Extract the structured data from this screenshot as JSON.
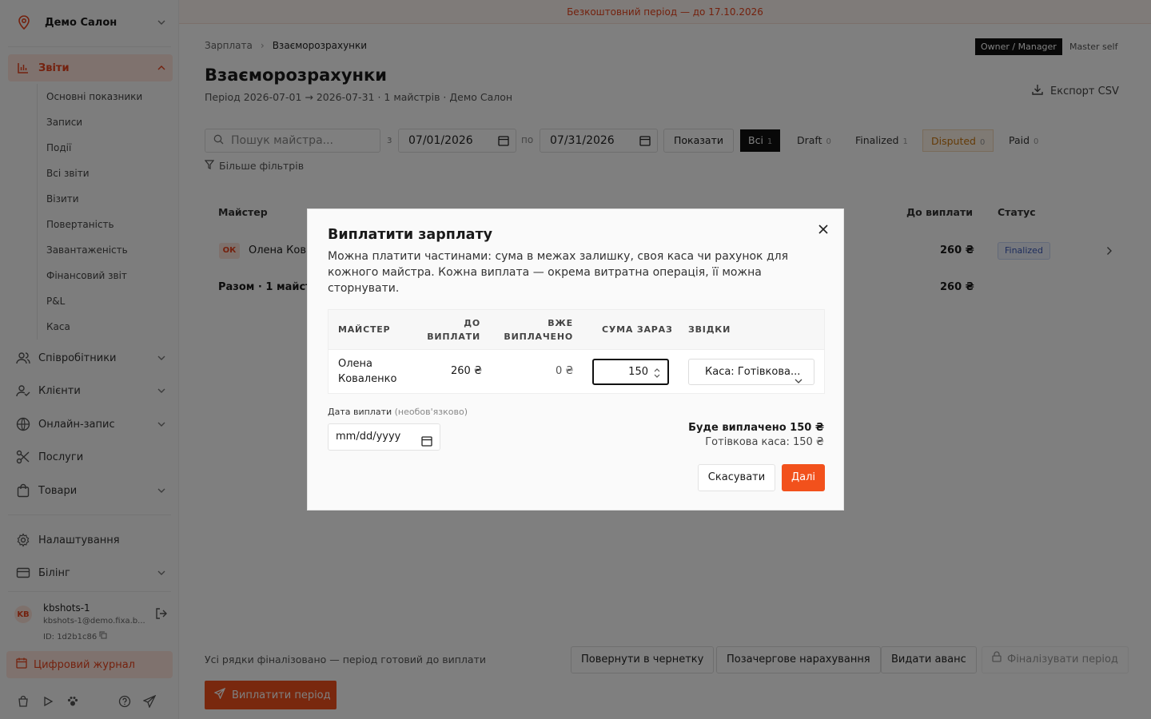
{
  "banner": "Безкоштовний період — до 17.10.2026",
  "sidebar": {
    "salon_name": "Демо Салон",
    "reports": {
      "label": "Звіти",
      "items": [
        "Основні показники",
        "Записи",
        "Події",
        "Всі звіти",
        "Візити",
        "Повертаність",
        "Завантаженість",
        "Фінансовий звіт",
        "P&L",
        "Каса"
      ]
    },
    "nav": [
      "Співробітники",
      "Клієнти",
      "Онлайн-запис",
      "Послуги",
      "Товари",
      "Налаштування",
      "Білінг"
    ],
    "user": {
      "initials": "KB",
      "name": "kbshots-1",
      "email": "kbshots-1@demo.fixa.b...",
      "id": "ID: 1d2b1c86"
    },
    "journal": "Цифровий журнал"
  },
  "breadcrumb": [
    "Зарплата",
    "Взаєморозрахунки"
  ],
  "roles": {
    "owner": "Owner / Manager",
    "master": "Master self"
  },
  "page": {
    "title": "Взаєморозрахунки",
    "subtitle": "Період 2026-07-01 → 2026-07-31 · 1 майстрів · Демо Салон",
    "export": "Експорт CSV"
  },
  "filters": {
    "search_placeholder": "Пошук майстра...",
    "from_label": "з",
    "from_date": "07/01/2026",
    "to_label": "по",
    "to_date": "07/31/2026",
    "show": "Показати",
    "segments": [
      {
        "label": "Всі",
        "count": "1"
      },
      {
        "label": "Draft",
        "count": "0"
      },
      {
        "label": "Finalized",
        "count": "1"
      },
      {
        "label": "Disputed",
        "count": "0"
      },
      {
        "label": "Paid",
        "count": "0"
      }
    ],
    "more": "Більше фільтрів"
  },
  "table": {
    "col_master": "Майстер",
    "col_due": "До виплати",
    "col_status": "Статус",
    "row": {
      "initials": "ОК",
      "name": "Олена Ков",
      "due": "260 ₴",
      "status": "Finalized"
    },
    "total_label": "Разом · 1 майст",
    "total_due": "260 ₴"
  },
  "footer": {
    "note": "Усі рядки фіналізовано — період готовий до виплати",
    "revert": "Повернути в чернетку",
    "extra": "Позачергове нарахування",
    "advance": "Видати аванс",
    "finalize": "Фіналізувати період",
    "pay": "Виплатити період"
  },
  "modal": {
    "title": "Виплатити зарплату",
    "description": "Можна платити частинами: сума в межах залишку, своя каса чи рахунок для кожного майстра. Кожна виплата — окрема витратна операція, її можна сторнувати.",
    "headers": {
      "master": "МАЙСТЕР",
      "due_1": "ДО",
      "due_2": "ВИПЛАТИ",
      "paid_1": "ВЖЕ",
      "paid_2": "ВИПЛАЧЕНО",
      "amount": "СУМА ЗАРАЗ",
      "source": "ЗВІДКИ"
    },
    "row": {
      "name": "Олена Коваленко",
      "due": "260 ₴",
      "paid": "0 ₴",
      "amount": "150",
      "source": "Каса: Готівкова..."
    },
    "date_label": "Дата виплати",
    "date_optional": "(необов'язково)",
    "date_placeholder": "mm/dd/yyyy",
    "summary": "Буде виплачено 150 ₴",
    "summary_detail": "Готівкова каса: 150 ₴",
    "cancel": "Скасувати",
    "next": "Далі"
  },
  "colors": {
    "accent": "#f2511c",
    "accent_soft": "#ffe5dc",
    "overlay": "rgba(0,0,0,0.5)"
  }
}
